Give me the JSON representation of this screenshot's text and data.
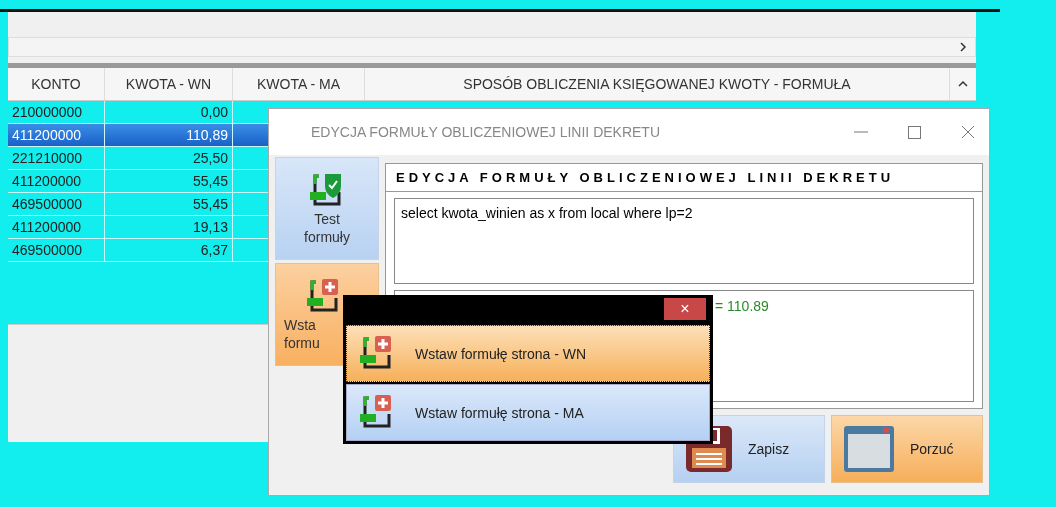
{
  "grid": {
    "columns": [
      "KONTO",
      "KWOTA - WN",
      "KWOTA - MA",
      "SPOSÓB OBLICZENIA KSIĘGOWANEJ KWOTY - FORMUŁA"
    ],
    "rows": [
      {
        "konto": "210000000",
        "wn": "0,00",
        "selected": false
      },
      {
        "konto": "411200000",
        "wn": "110,89",
        "selected": true
      },
      {
        "konto": "221210000",
        "wn": "25,50",
        "selected": false
      },
      {
        "konto": "411200000",
        "wn": "55,45",
        "selected": false
      },
      {
        "konto": "469500000",
        "wn": "55,45",
        "selected": false
      },
      {
        "konto": "411200000",
        "wn": "19,13",
        "selected": false
      },
      {
        "konto": "469500000",
        "wn": "6,37",
        "selected": false
      }
    ]
  },
  "dialog": {
    "title": "EDYCJA FORMUŁY OBLICZENIOWEJ LINII DEKRETU",
    "side_buttons": [
      {
        "kind": "test",
        "lines": [
          "Test",
          "formuły"
        ],
        "highlighted": false
      },
      {
        "kind": "insert",
        "lines": [
          "Wsta",
          "formu"
        ],
        "highlighted": true
      }
    ],
    "header": "EDYCJA FORMUŁY OBLICZENIOWEJ LINII DEKRETU",
    "formula": "select kwota_winien as x from local where lp=2",
    "result": "= 110.89",
    "buttons": [
      {
        "kind": "save",
        "label": "Zapisz",
        "highlighted": false
      },
      {
        "kind": "cancel",
        "label": "Porzuć",
        "highlighted": true
      }
    ]
  },
  "popup": {
    "close": "×",
    "items": [
      {
        "label": "Wstaw formułę strona - WN",
        "selected": true
      },
      {
        "label": "Wstaw formułę strona - MA",
        "selected": false
      }
    ]
  }
}
